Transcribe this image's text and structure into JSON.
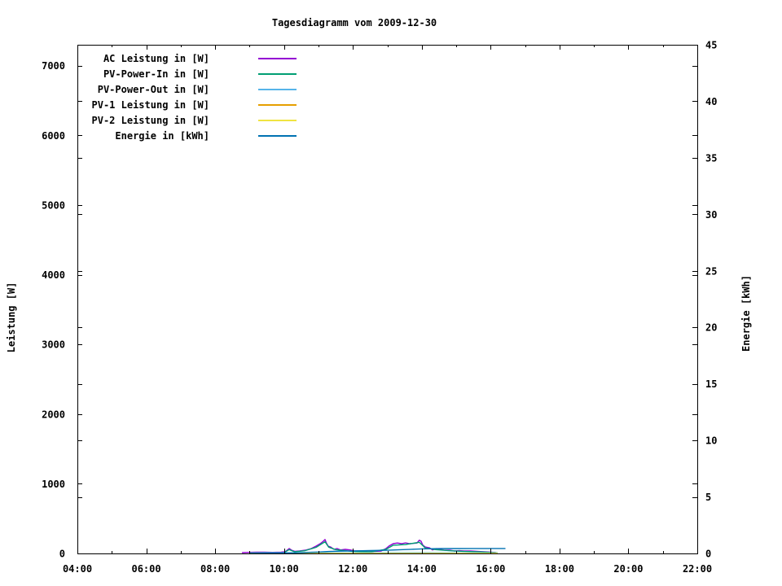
{
  "title": "Tagesdiagramm vom 2009-12-30",
  "chart_data": {
    "type": "line",
    "title": "Tagesdiagramm vom 2009-12-30",
    "legend_position": "top-left-inside",
    "grid": false,
    "x_axis": {
      "range_hours": [
        4,
        22
      ],
      "minor_tick_every_hours": 1,
      "major_ticks": [
        {
          "h": 4,
          "label": "04:00"
        },
        {
          "h": 6,
          "label": "06:00"
        },
        {
          "h": 8,
          "label": "08:00"
        },
        {
          "h": 10,
          "label": "10:00"
        },
        {
          "h": 12,
          "label": "12:00"
        },
        {
          "h": 14,
          "label": "14:00"
        },
        {
          "h": 16,
          "label": "16:00"
        },
        {
          "h": 18,
          "label": "18:00"
        },
        {
          "h": 20,
          "label": "20:00"
        },
        {
          "h": 22,
          "label": "22:00"
        }
      ]
    },
    "y_left": {
      "label": "Leistung [W]",
      "range": [
        0,
        7300
      ],
      "ticks": [
        0,
        1000,
        2000,
        3000,
        4000,
        5000,
        6000,
        7000
      ]
    },
    "y_right": {
      "label": "Energie [kWh]",
      "range": [
        0,
        45
      ],
      "ticks": [
        0,
        5,
        10,
        15,
        20,
        25,
        30,
        35,
        40,
        45
      ]
    },
    "series": [
      {
        "name": "AC Leistung in [W]",
        "color": "#9400D3",
        "axis": "left",
        "points": [
          [
            8.78,
            12
          ],
          [
            8.97,
            15
          ],
          [
            9.2,
            18
          ],
          [
            9.44,
            18
          ],
          [
            9.67,
            15
          ],
          [
            9.91,
            18
          ],
          [
            10.03,
            23
          ],
          [
            10.15,
            70
          ],
          [
            10.22,
            47
          ],
          [
            10.31,
            30
          ],
          [
            10.45,
            35
          ],
          [
            10.62,
            47
          ],
          [
            10.79,
            70
          ],
          [
            10.93,
            105
          ],
          [
            11.05,
            140
          ],
          [
            11.14,
            175
          ],
          [
            11.19,
            200
          ],
          [
            11.23,
            150
          ],
          [
            11.28,
            105
          ],
          [
            11.35,
            94
          ],
          [
            11.45,
            60
          ],
          [
            11.54,
            70
          ],
          [
            11.64,
            50
          ],
          [
            11.78,
            58
          ],
          [
            11.92,
            50
          ],
          [
            12.06,
            35
          ],
          [
            12.25,
            35
          ],
          [
            12.44,
            25
          ],
          [
            12.63,
            30
          ],
          [
            12.82,
            35
          ],
          [
            12.96,
            70
          ],
          [
            13.06,
            110
          ],
          [
            13.17,
            140
          ],
          [
            13.29,
            150
          ],
          [
            13.41,
            140
          ],
          [
            13.53,
            152
          ],
          [
            13.65,
            140
          ],
          [
            13.77,
            145
          ],
          [
            13.86,
            150
          ],
          [
            13.93,
            190
          ],
          [
            13.98,
            175
          ],
          [
            14.03,
            120
          ],
          [
            14.1,
            94
          ],
          [
            14.22,
            82
          ],
          [
            14.31,
            50
          ],
          [
            14.43,
            70
          ],
          [
            14.55,
            58
          ],
          [
            14.66,
            47
          ],
          [
            14.81,
            47
          ],
          [
            14.95,
            35
          ],
          [
            15.09,
            40
          ],
          [
            15.23,
            35
          ],
          [
            15.42,
            35
          ],
          [
            15.61,
            30
          ],
          [
            15.8,
            25
          ],
          [
            15.96,
            20
          ],
          [
            16.08,
            15
          ],
          [
            16.15,
            12
          ]
        ]
      },
      {
        "name": "PV-Power-In in [W]",
        "color": "#009E73",
        "axis": "left",
        "points": [
          [
            9,
            8
          ],
          [
            9.5,
            10
          ],
          [
            10,
            12
          ],
          [
            10.15,
            55
          ],
          [
            10.3,
            25
          ],
          [
            10.6,
            38
          ],
          [
            10.93,
            88
          ],
          [
            11.19,
            168
          ],
          [
            11.3,
            90
          ],
          [
            11.5,
            55
          ],
          [
            12,
            28
          ],
          [
            12.5,
            22
          ],
          [
            12.96,
            58
          ],
          [
            13.17,
            118
          ],
          [
            13.53,
            128
          ],
          [
            13.93,
            160
          ],
          [
            14.1,
            80
          ],
          [
            14.4,
            55
          ],
          [
            14.8,
            40
          ],
          [
            15.2,
            30
          ],
          [
            15.7,
            22
          ],
          [
            16.1,
            12
          ],
          [
            16.2,
            8
          ]
        ]
      },
      {
        "name": "PV-Power-Out in [W]",
        "color": "#56B4E9",
        "axis": "left",
        "points": [
          [
            9,
            6
          ],
          [
            10,
            8
          ],
          [
            11,
            10
          ],
          [
            12,
            8
          ],
          [
            13,
            9
          ],
          [
            14,
            10
          ],
          [
            15,
            8
          ],
          [
            16,
            6
          ],
          [
            16.2,
            5
          ]
        ]
      },
      {
        "name": "PV-1 Leistung in [W]",
        "color": "#E69F00",
        "axis": "left",
        "points": [
          [
            9,
            0
          ],
          [
            16.2,
            0
          ]
        ]
      },
      {
        "name": "PV-2 Leistung in [W]",
        "color": "#F0E442",
        "axis": "left",
        "points": [
          [
            9,
            0
          ],
          [
            16.2,
            0
          ]
        ]
      },
      {
        "name": "Energie in [kWh]",
        "color": "#0072B2",
        "axis": "right",
        "points": [
          [
            9,
            0
          ],
          [
            9.5,
            0.02
          ],
          [
            10,
            0.04
          ],
          [
            10.5,
            0.07
          ],
          [
            11,
            0.12
          ],
          [
            11.3,
            0.17
          ],
          [
            11.6,
            0.2
          ],
          [
            12,
            0.22
          ],
          [
            12.5,
            0.25
          ],
          [
            13,
            0.28
          ],
          [
            13.3,
            0.32
          ],
          [
            13.7,
            0.37
          ],
          [
            14,
            0.4
          ],
          [
            14.3,
            0.42
          ],
          [
            14.6,
            0.43
          ],
          [
            15,
            0.43
          ],
          [
            15.5,
            0.44
          ],
          [
            16,
            0.44
          ],
          [
            16.43,
            0.44
          ]
        ]
      }
    ]
  }
}
